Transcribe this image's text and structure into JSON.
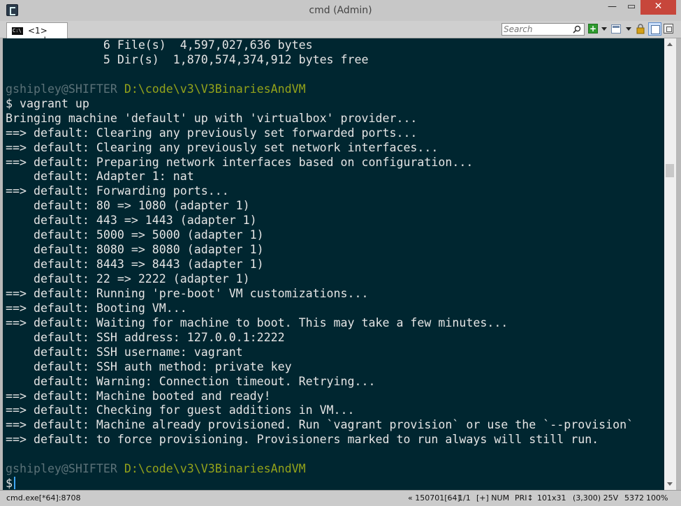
{
  "window": {
    "title": "cmd (Admin)",
    "minimize": "—",
    "maximize": "▭",
    "close": "✕"
  },
  "tabs": [
    {
      "icon_text": "C:\\",
      "label": "<1> cmd"
    }
  ],
  "search": {
    "placeholder": "Search"
  },
  "toolbar": {
    "add": "+"
  },
  "terminal": {
    "lines": [
      [
        {
          "t": "              6 File(s)  4,597,027,636 bytes",
          "c": ""
        }
      ],
      [
        {
          "t": "              5 Dir(s)  1,870,574,374,912 bytes free",
          "c": ""
        }
      ],
      [
        {
          "t": "",
          "c": ""
        }
      ],
      [
        {
          "t": "gshipley@SHIFTER ",
          "c": "c-user"
        },
        {
          "t": "D:\\code\\v3\\V3BinariesAndVM",
          "c": "c-path"
        }
      ],
      [
        {
          "t": "$ vagrant up",
          "c": ""
        }
      ],
      [
        {
          "t": "Bringing machine 'default' up with 'virtualbox' provider...",
          "c": ""
        }
      ],
      [
        {
          "t": "==> default: Clearing any previously set forwarded ports...",
          "c": ""
        }
      ],
      [
        {
          "t": "==> default: Clearing any previously set network interfaces...",
          "c": ""
        }
      ],
      [
        {
          "t": "==> default: Preparing network interfaces based on configuration...",
          "c": ""
        }
      ],
      [
        {
          "t": "    default: Adapter 1: nat",
          "c": ""
        }
      ],
      [
        {
          "t": "==> default: Forwarding ports...",
          "c": ""
        }
      ],
      [
        {
          "t": "    default: 80 => 1080 (adapter 1)",
          "c": ""
        }
      ],
      [
        {
          "t": "    default: 443 => 1443 (adapter 1)",
          "c": ""
        }
      ],
      [
        {
          "t": "    default: 5000 => 5000 (adapter 1)",
          "c": ""
        }
      ],
      [
        {
          "t": "    default: 8080 => 8080 (adapter 1)",
          "c": ""
        }
      ],
      [
        {
          "t": "    default: 8443 => 8443 (adapter 1)",
          "c": ""
        }
      ],
      [
        {
          "t": "    default: 22 => 2222 (adapter 1)",
          "c": ""
        }
      ],
      [
        {
          "t": "==> default: Running 'pre-boot' VM customizations...",
          "c": ""
        }
      ],
      [
        {
          "t": "==> default: Booting VM...",
          "c": ""
        }
      ],
      [
        {
          "t": "==> default: Waiting for machine to boot. This may take a few minutes...",
          "c": ""
        }
      ],
      [
        {
          "t": "    default: SSH address: 127.0.0.1:2222",
          "c": ""
        }
      ],
      [
        {
          "t": "    default: SSH username: vagrant",
          "c": ""
        }
      ],
      [
        {
          "t": "    default: SSH auth method: private key",
          "c": ""
        }
      ],
      [
        {
          "t": "    default: Warning: Connection timeout. Retrying...",
          "c": ""
        }
      ],
      [
        {
          "t": "==> default: Machine booted and ready!",
          "c": ""
        }
      ],
      [
        {
          "t": "==> default: Checking for guest additions in VM...",
          "c": ""
        }
      ],
      [
        {
          "t": "==> default: Machine already provisioned. Run `vagrant provision` or use the `--provision`",
          "c": ""
        }
      ],
      [
        {
          "t": "==> default: to force provisioning. Provisioners marked to run always will still run.",
          "c": ""
        }
      ],
      [
        {
          "t": "",
          "c": ""
        }
      ],
      [
        {
          "t": "gshipley@SHIFTER ",
          "c": "c-user"
        },
        {
          "t": "D:\\code\\v3\\V3BinariesAndVM",
          "c": "c-path"
        }
      ],
      [
        {
          "t": "$",
          "c": "",
          "cursor": true
        }
      ]
    ],
    "colors": {
      "background": "#002630",
      "text": "#e5e5e5",
      "user": "#5b7278",
      "path": "#93a31a",
      "cursor": "#3fa7f5"
    }
  },
  "status": {
    "process": "cmd.exe[*64]:8708",
    "server": "« 150701[64]",
    "tab_index": "1/1",
    "insert": "[+] NUM",
    "priority": "PRI↕",
    "size": "101x31",
    "cursor_pos": "(3,300) 25V",
    "pid": "5372",
    "transparency": "100%"
  }
}
